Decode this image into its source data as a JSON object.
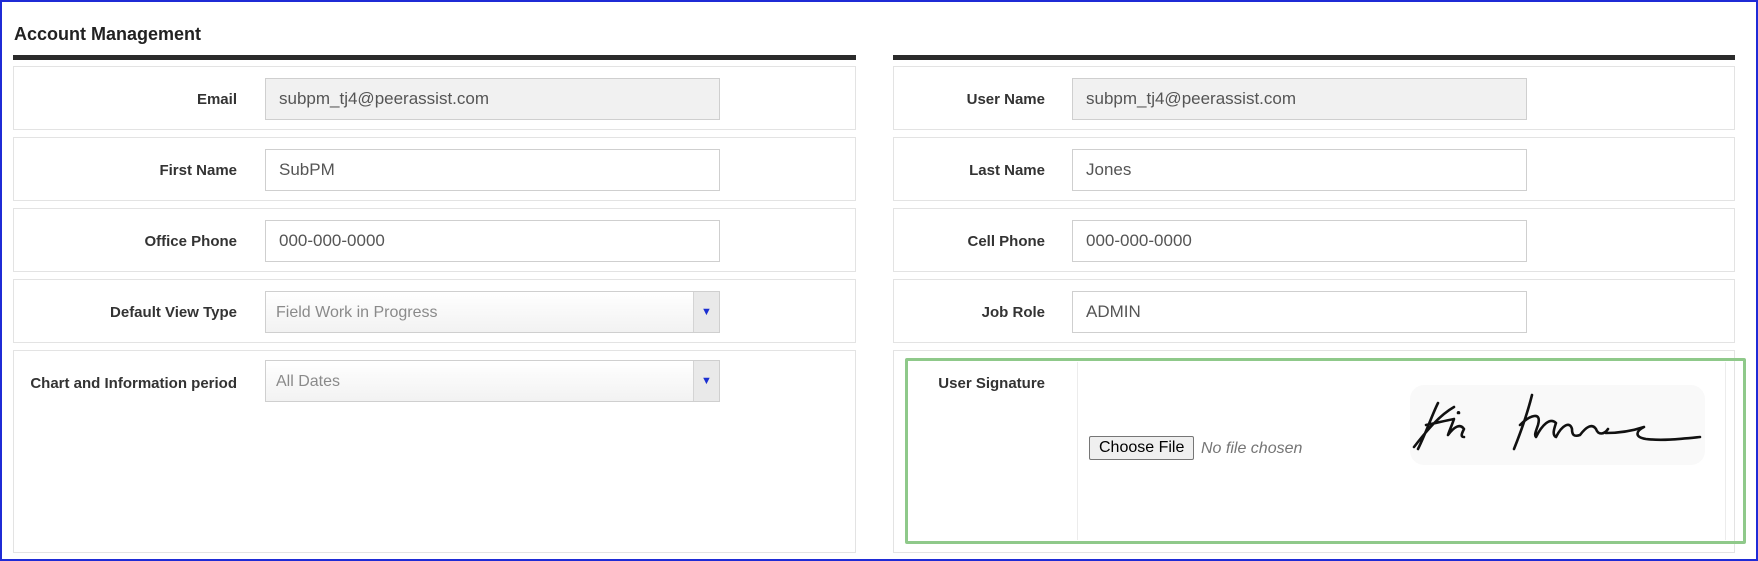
{
  "section": {
    "title": "Account Management"
  },
  "left": {
    "email": {
      "label": "Email",
      "value": "subpm_tj4@peerassist.com"
    },
    "first_name": {
      "label": "First Name",
      "value": "SubPM"
    },
    "office_phone": {
      "label": "Office Phone",
      "value": "000-000-0000"
    },
    "default_view_type": {
      "label": "Default View Type",
      "selected": "Field Work in Progress"
    },
    "chart_period": {
      "label": "Chart and Information period",
      "selected": "All Dates"
    }
  },
  "right": {
    "user_name": {
      "label": "User Name",
      "value": "subpm_tj4@peerassist.com"
    },
    "last_name": {
      "label": "Last Name",
      "value": "Jones"
    },
    "cell_phone": {
      "label": "Cell Phone",
      "value": "000-000-0000"
    },
    "job_role": {
      "label": "Job Role",
      "value": "ADMIN"
    },
    "signature": {
      "label": "User Signature",
      "choose_file_label": "Choose File",
      "file_status": "No file chosen"
    }
  },
  "icons": {
    "select_arrow": "triangle-down-icon"
  },
  "colors": {
    "frame": "#1f2bd6",
    "highlight": "#8fc98a",
    "arrow": "#1b2fd1"
  }
}
